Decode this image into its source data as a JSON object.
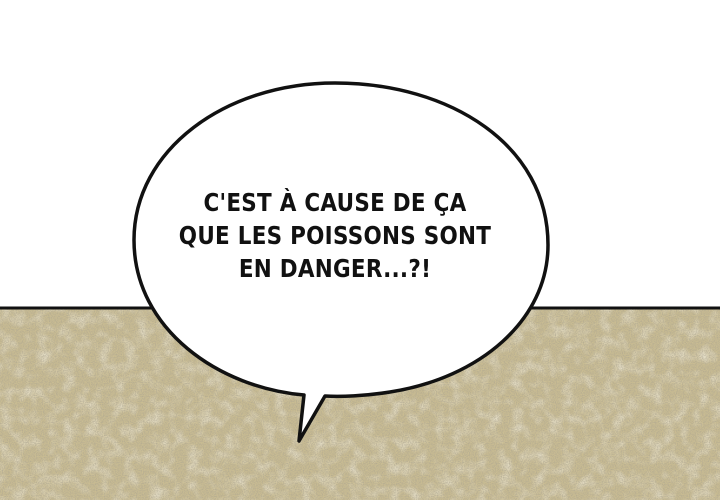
{
  "speech_bubble": {
    "lines": [
      "C'EST À CAUSE DE ÇA",
      "QUE LES POISSONS SONT",
      "EN DANGER...?!"
    ]
  },
  "colors": {
    "ground": "#c9bc92",
    "ground_shadow": "#a89c74",
    "outline": "#111111",
    "bubble_fill": "#ffffff",
    "sky": "#ffffff"
  }
}
